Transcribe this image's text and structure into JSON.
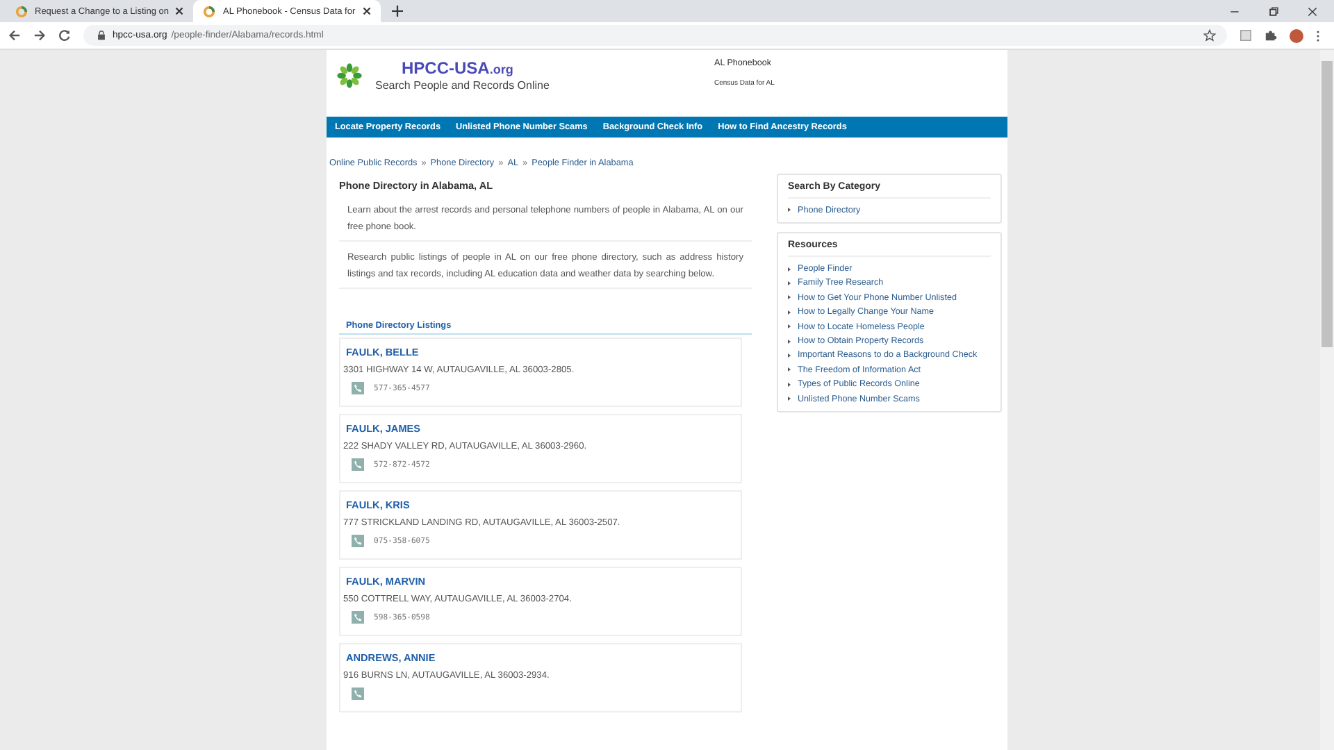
{
  "browser": {
    "tabs": [
      {
        "title": "Request a Change to a Listing on",
        "selected": false
      },
      {
        "title": "AL Phonebook - Census Data for",
        "selected": true
      }
    ],
    "url_host": "hpcc-usa.org",
    "url_path": "/people-finder/Alabama/records.html"
  },
  "header": {
    "site_name": "HPCC-USA",
    "site_tld": ".org",
    "tagline": "Search People and Records Online",
    "page_title": "AL Phonebook",
    "page_subtitle": "Census Data for AL"
  },
  "nav": [
    "Locate Property Records",
    "Unlisted Phone Number Scams",
    "Background Check Info",
    "How to Find Ancestry Records"
  ],
  "breadcrumb": [
    {
      "label": "Online Public Records"
    },
    {
      "separator": "»",
      "label": "Phone Directory"
    },
    {
      "separator": "»",
      "label": "AL"
    },
    {
      "separator": "»",
      "label": "People Finder in Alabama"
    }
  ],
  "main": {
    "heading": "Phone Directory in Alabama, AL",
    "paragraphs": [
      "Learn about the arrest records and personal telephone numbers of people in Alabama, AL on our free phone book.",
      "Research public listings of people in AL on our free phone directory, such as address history listings and tax records, including AL education data and weather data by searching below."
    ],
    "listings_title": "Phone Directory Listings",
    "listings": [
      {
        "name": "FAULK, BELLE",
        "address": "3301 HIGHWAY 14 W, AUTAUGAVILLE, AL 36003-2805.",
        "phone": "577-365-4577"
      },
      {
        "name": "FAULK, JAMES",
        "address": "222 SHADY VALLEY RD, AUTAUGAVILLE, AL 36003-2960.",
        "phone": "572-872-4572"
      },
      {
        "name": "FAULK, KRIS",
        "address": "777 STRICKLAND LANDING RD, AUTAUGAVILLE, AL 36003-2507.",
        "phone": "075-358-6075"
      },
      {
        "name": "FAULK, MARVIN",
        "address": "550 COTTRELL WAY, AUTAUGAVILLE, AL 36003-2704.",
        "phone": "598-365-0598"
      },
      {
        "name": "ANDREWS, ANNIE",
        "address": "916 BURNS LN, AUTAUGAVILLE, AL 36003-2934."
      }
    ]
  },
  "sidebar": [
    {
      "title": "Search By Category",
      "links": [
        "Phone Directory"
      ]
    },
    {
      "title": "Resources",
      "links": [
        "People Finder",
        "Family Tree Research",
        "How to Get Your Phone Number Unlisted",
        "How to Legally Change Your Name",
        "How to Locate Homeless People",
        "How to Obtain Property Records",
        "Important Reasons to do a Background Check",
        "The Freedom of Information Act",
        "Types of Public Records Online",
        "Unlisted Phone Number Scams"
      ]
    }
  ]
}
